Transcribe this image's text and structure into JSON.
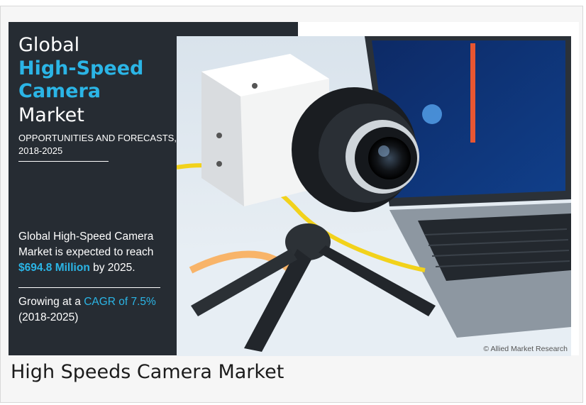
{
  "banner": {
    "title_line1": "Global",
    "title_highlight": "High-Speed Camera",
    "title_line3": "Market",
    "subtitle": "OPPORTUNITIES AND FORECASTS, 2018-2025",
    "reach_text_before": "Global High-Speed Camera Market is expected to reach ",
    "reach_value": "$694.8 Million",
    "reach_text_after": " by 2025.",
    "cagr_text_before": "Growing at a ",
    "cagr_value": "CAGR of 7.5%",
    "cagr_text_after": " (2018-2025)",
    "copyright": "© Allied Market Research"
  },
  "caption": "High Speeds Camera Market",
  "colors": {
    "panel": "#262c33",
    "accent": "#2bb5e6"
  }
}
